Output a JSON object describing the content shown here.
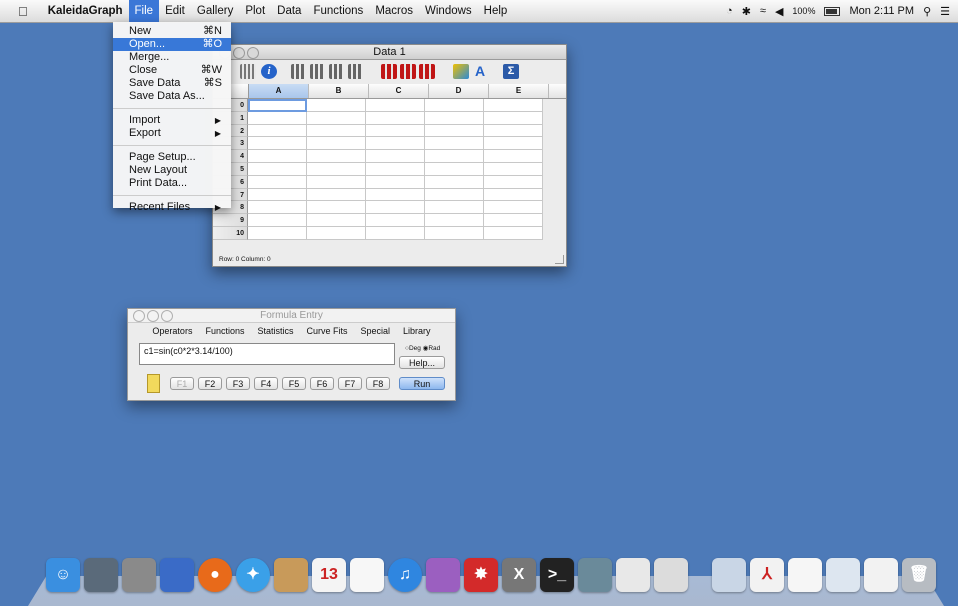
{
  "menubar": {
    "apple": "",
    "app_name": "KaleidaGraph",
    "menus": [
      "File",
      "Edit",
      "Gallery",
      "Plot",
      "Data",
      "Functions",
      "Macros",
      "Windows",
      "Help"
    ],
    "right": {
      "battery_pct": "100%",
      "clock": "Mon 2:11 PM"
    }
  },
  "file_menu": {
    "items": [
      {
        "label": "New",
        "shortcut": "⌘N"
      },
      {
        "label": "Open...",
        "shortcut": "⌘O"
      },
      {
        "label": "Merge...",
        "shortcut": ""
      },
      {
        "label": "Close",
        "shortcut": "⌘W"
      },
      {
        "label": "Save Data",
        "shortcut": "⌘S"
      },
      {
        "label": "Save Data As...",
        "shortcut": ""
      },
      {
        "label": "Import",
        "shortcut": ""
      },
      {
        "label": "Export",
        "shortcut": ""
      },
      {
        "label": "Page Setup...",
        "shortcut": ""
      },
      {
        "label": "New Layout",
        "shortcut": ""
      },
      {
        "label": "Print Data...",
        "shortcut": ""
      },
      {
        "label": "Recent Files",
        "shortcut": ""
      }
    ],
    "selected": "Open..."
  },
  "data_window": {
    "title": "Data 1",
    "columns": [
      "A",
      "B",
      "C",
      "D",
      "E"
    ],
    "rows": [
      "0",
      "1",
      "2",
      "3",
      "4",
      "5",
      "6",
      "7",
      "8",
      "9",
      "10"
    ],
    "status": "Row: 0  Column: 0"
  },
  "formula_window": {
    "title": "Formula Entry",
    "menus": [
      "Operators",
      "Functions",
      "Statistics",
      "Curve Fits",
      "Special",
      "Library"
    ],
    "formula": "c1=sin(c0*2*3.14/100)",
    "deg_label": "Deg",
    "rad_label": "Rad",
    "help_label": "Help...",
    "fkeys": [
      "F1",
      "F2",
      "F3",
      "F4",
      "F5",
      "F6",
      "F7",
      "F8"
    ],
    "run_label": "Run"
  },
  "dock": {
    "apps": [
      "finder",
      "utilities",
      "system-preferences",
      "kaleidagraph",
      "firefox",
      "safari",
      "contacts",
      "calendar",
      "reminders",
      "itunes",
      "colorsync",
      "mathematica",
      "x11",
      "terminal",
      "texshop",
      "textedit",
      "xcode",
      "downloads",
      "adobe-reader",
      "documents",
      "preview",
      "text-file",
      "trash"
    ],
    "calendar_day": "13"
  },
  "colors": {
    "desktop": "#4d7ab8",
    "menu_highlight": "#3878d8",
    "accent_blue": "#2563c9"
  }
}
